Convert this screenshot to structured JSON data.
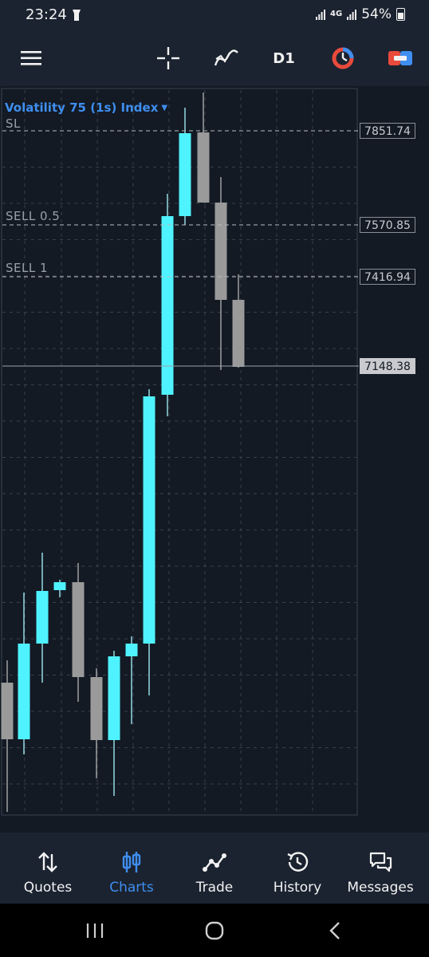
{
  "status_bar": {
    "time": "23:24",
    "network": "4G",
    "battery": "54%"
  },
  "toolbar": {
    "timeframe": "D1",
    "icons": [
      "menu-icon",
      "crosshair-icon",
      "indicators-icon",
      "one-click-trading-icon",
      "trade-icon"
    ]
  },
  "chart": {
    "symbol": "Volatility 75 (1s) Index",
    "order_labels": {
      "sl": "SL",
      "sell_half": "SELL 0.5",
      "sell_one": "SELL 1"
    },
    "price_labels": {
      "sl": "7851.74",
      "sell_half": "7570.85",
      "sell_one": "7416.94",
      "current": "7148.38"
    },
    "colors": {
      "bull": "#4ef3ff",
      "bear": "#9a9a9a",
      "background": "#131a24"
    }
  },
  "bottom_nav": {
    "quotes": "Quotes",
    "charts": "Charts",
    "trade": "Trade",
    "history": "History",
    "messages": "Messages"
  }
}
